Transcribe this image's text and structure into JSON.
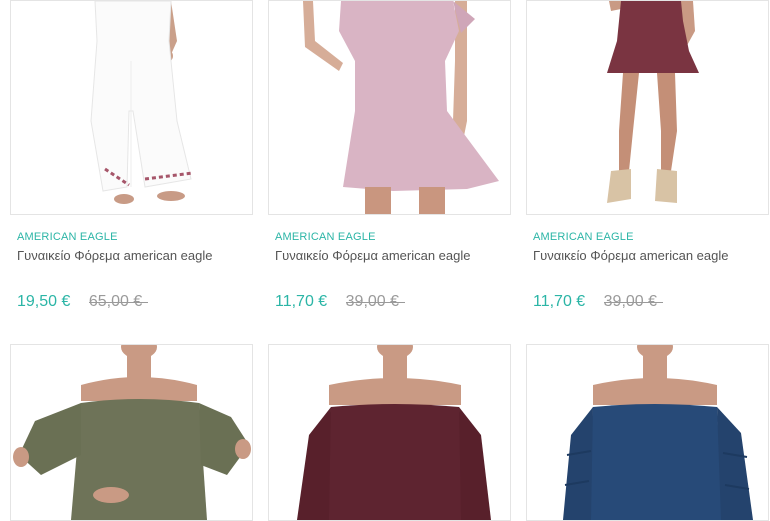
{
  "products": [
    {
      "brand": "AMERICAN EAGLE",
      "title": "Γυναικείο Φόρεμα american eagle",
      "price": "19,50 €",
      "old_price": "65,00 €",
      "image": "white-wide-leg-jumpsuit",
      "color": "#ffffff"
    },
    {
      "brand": "AMERICAN EAGLE",
      "title": "Γυναικείο Φόρεμα american eagle",
      "price": "11,70 €",
      "old_price": "39,00 €",
      "image": "pink-tshirt-dress",
      "color": "#d9b4c4"
    },
    {
      "brand": "AMERICAN EAGLE",
      "title": "Γυναικείο Φόρεμα american eagle",
      "price": "11,70 €",
      "old_price": "39,00 €",
      "image": "burgundy-skater-dress",
      "color": "#7a3441"
    },
    {
      "image": "olive-off-shoulder-top",
      "color": "#6e7358"
    },
    {
      "image": "burgundy-off-shoulder-top",
      "color": "#5e2430"
    },
    {
      "image": "navy-off-shoulder-top",
      "color": "#274a78"
    }
  ],
  "colors": {
    "accent": "#2bb5a6",
    "muted": "#9a9a9a",
    "text": "#555555",
    "border": "#e4e4e4"
  }
}
